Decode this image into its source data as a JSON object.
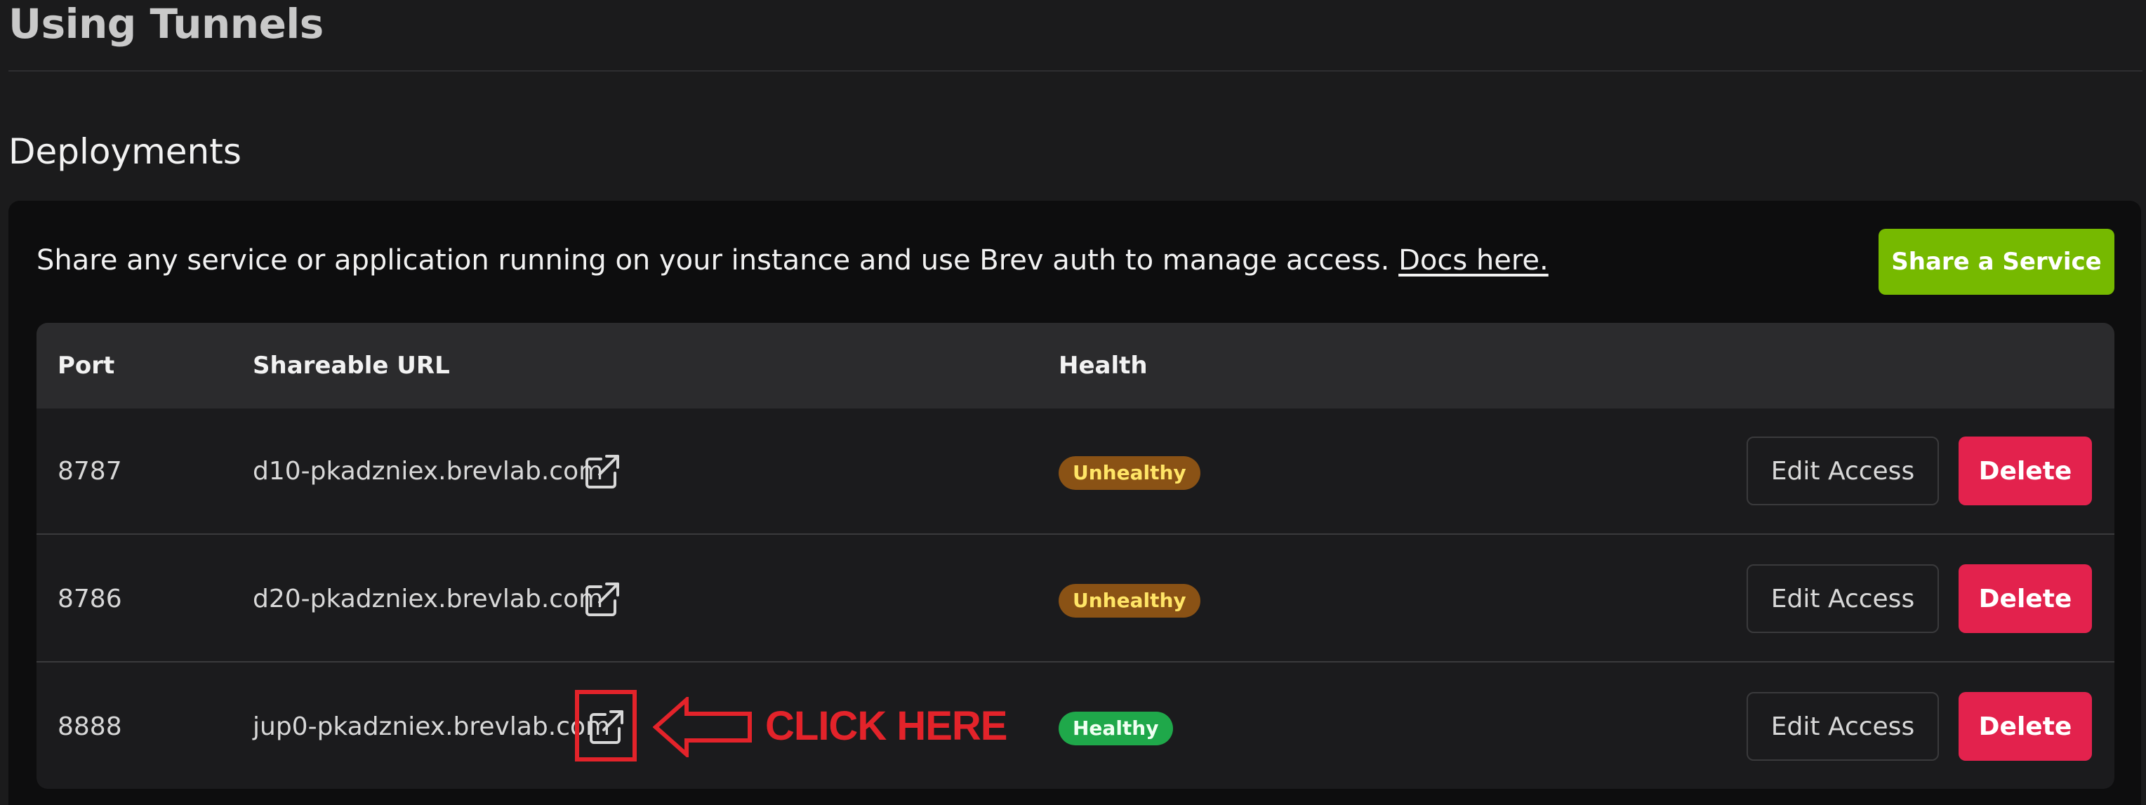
{
  "page": {
    "title": "Using Tunnels"
  },
  "deployments": {
    "heading": "Deployments",
    "description": "Share any service or application running on your instance and use Brev auth to manage access.",
    "docs_link": "Docs here.",
    "share_button": "Share a Service",
    "table": {
      "headers": {
        "port": "Port",
        "url": "Shareable URL",
        "health": "Health"
      },
      "rows": [
        {
          "port": "8787",
          "url": "d10-pkadzniex.brevlab.com",
          "health": "Unhealthy",
          "edit_label": "Edit Access",
          "delete_label": "Delete"
        },
        {
          "port": "8786",
          "url": "d20-pkadzniex.brevlab.com",
          "health": "Unhealthy",
          "edit_label": "Edit Access",
          "delete_label": "Delete"
        },
        {
          "port": "8888",
          "url": "jup0-pkadzniex.brevlab.com",
          "health": "Healthy",
          "edit_label": "Edit Access",
          "delete_label": "Delete"
        }
      ]
    }
  },
  "annotation": {
    "label": "CLICK HERE",
    "color": "#e3232a"
  },
  "colors": {
    "accent_green": "#76b900",
    "delete_red": "#e3224d",
    "unhealthy_bg": "#8a5215",
    "unhealthy_text": "#ffe566",
    "healthy_bg": "#1fa84a"
  },
  "icons": {
    "external_link": "external-link-icon",
    "annotation_arrow": "left-arrow-icon"
  }
}
